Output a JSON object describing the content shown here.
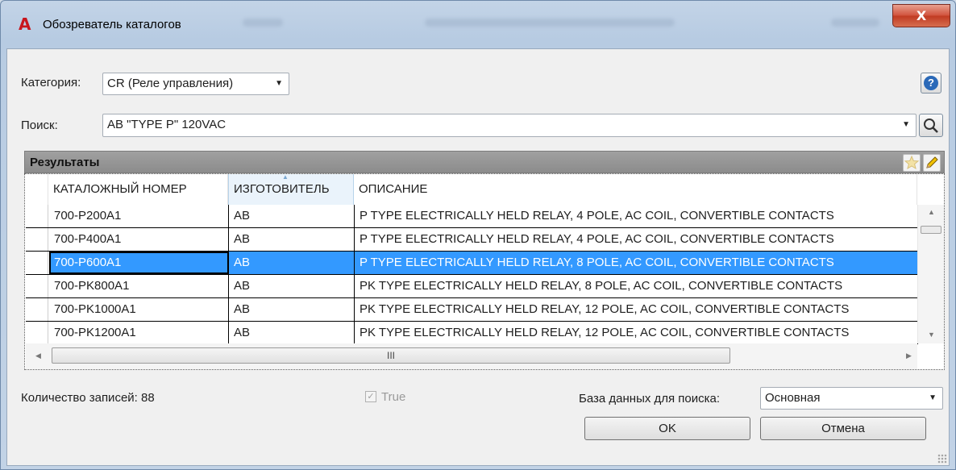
{
  "window": {
    "title": "Обозреватель каталогов",
    "close_label": "X"
  },
  "toolbar": {
    "category_label": "Категория:",
    "category_value": "CR (Реле управления)",
    "help_label": "?",
    "search_label": "Поиск:",
    "search_value": "AB \"TYPE P\" 120VAC"
  },
  "results": {
    "title": "Результаты",
    "columns": [
      "КАТАЛОЖНЫЙ НОМЕР",
      "ИЗГОТОВИТЕЛЬ",
      "ОПИСАНИЕ"
    ],
    "rows": [
      [
        "700-P200A1",
        "AB",
        "P TYPE ELECTRICALLY HELD RELAY, 4 POLE, AC COIL, CONVERTIBLE CONTACTS"
      ],
      [
        "700-P400A1",
        "AB",
        "P TYPE ELECTRICALLY HELD RELAY, 4 POLE, AC COIL, CONVERTIBLE CONTACTS"
      ],
      [
        "700-P600A1",
        "AB",
        "P TYPE ELECTRICALLY HELD RELAY, 8 POLE, AC COIL, CONVERTIBLE CONTACTS"
      ],
      [
        "700-PK800A1",
        "AB",
        "PK TYPE ELECTRICALLY HELD RELAY, 8 POLE, AC COIL, CONVERTIBLE CONTACTS"
      ],
      [
        "700-PK1000A1",
        "AB",
        "PK TYPE ELECTRICALLY HELD RELAY, 12 POLE, AC COIL, CONVERTIBLE CONTACTS"
      ],
      [
        "700-PK1200A1",
        "AB",
        "PK TYPE ELECTRICALLY HELD RELAY, 12 POLE, AC COIL, CONVERTIBLE CONTACTS"
      ]
    ],
    "selected_row": 2,
    "hscroll_thumb": "III"
  },
  "footer": {
    "record_count": "Количество записей: 88",
    "checkbox_label": "True",
    "db_label": "База данных для поиска:",
    "db_value": "Основная",
    "ok_label": "OK",
    "cancel_label": "Отмена"
  },
  "icons": {
    "app": "autocad-logo-icon",
    "help": "help-icon",
    "search": "magnifier-icon",
    "favorite": "star-icon",
    "edit": "pencil-icon"
  },
  "colors": {
    "selection": "#3399ff",
    "app_logo": "#c8161d",
    "close_button": "#c8442e"
  }
}
